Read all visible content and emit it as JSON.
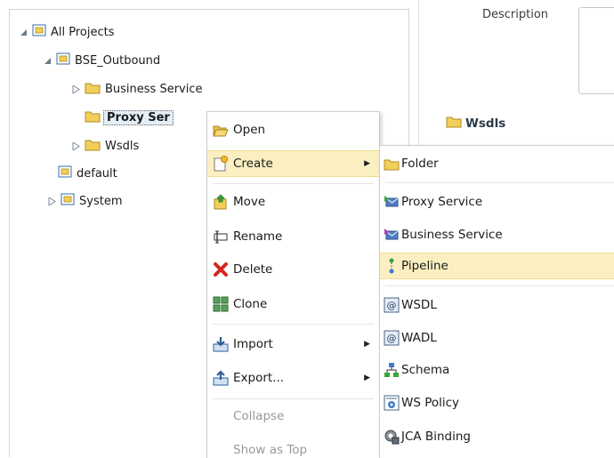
{
  "tree": {
    "root": "All Projects",
    "project": "BSE_Outbound",
    "business_service": "Business Service",
    "proxy_service": "Proxy Ser",
    "wsdls": "Wsdls",
    "default": "default",
    "system": "System"
  },
  "detail": {
    "description_label": "Description",
    "wsdls_heading": "Wsdls"
  },
  "context_menu": {
    "open": "Open",
    "create": "Create",
    "move": "Move",
    "rename": "Rename",
    "delete": "Delete",
    "clone": "Clone",
    "import": "Import",
    "export": "Export...",
    "collapse": "Collapse",
    "show_as_top": "Show as Top"
  },
  "create_submenu": {
    "folder": "Folder",
    "proxy_service": "Proxy Service",
    "business_service": "Business Service",
    "pipeline": "Pipeline",
    "wsdl": "WSDL",
    "wadl": "WADL",
    "schema": "Schema",
    "ws_policy": "WS Policy",
    "jca_binding": "JCA Binding"
  },
  "colors": {
    "highlight": "#fbefc2",
    "folder": "#f2cf58",
    "project_blue": "#3a6ea5"
  }
}
